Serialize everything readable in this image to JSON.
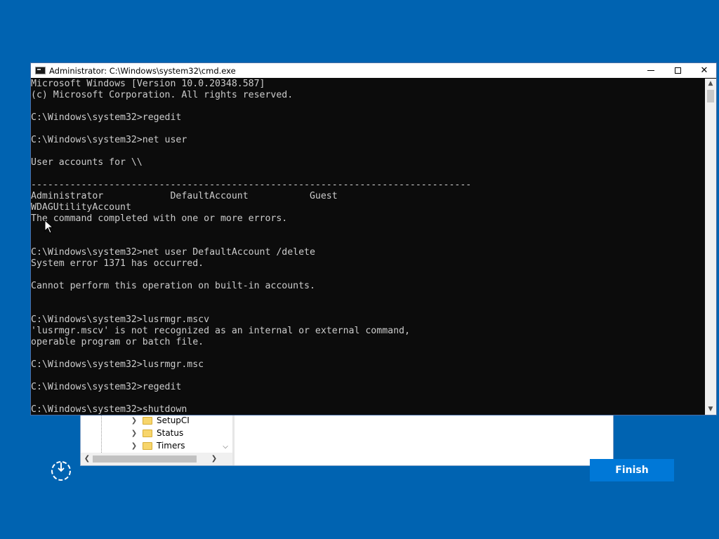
{
  "cmd": {
    "title": "Administrator: C:\\Windows\\system32\\cmd.exe",
    "lines": [
      "Microsoft Windows [Version 10.0.20348.587]",
      "(c) Microsoft Corporation. All rights reserved.",
      "",
      "C:\\Windows\\system32>regedit",
      "",
      "C:\\Windows\\system32>net user",
      "",
      "User accounts for \\\\",
      "",
      "-------------------------------------------------------------------------------",
      "Administrator            DefaultAccount           Guest",
      "WDAGUtilityAccount",
      "The command completed with one or more errors.",
      "",
      "",
      "C:\\Windows\\system32>net user DefaultAccount /delete",
      "System error 1371 has occurred.",
      "",
      "Cannot perform this operation on built-in accounts.",
      "",
      "",
      "C:\\Windows\\system32>lusrmgr.mscv",
      "'lusrmgr.mscv' is not recognized as an internal or external command,",
      "operable program or batch file.",
      "",
      "C:\\Windows\\system32>lusrmgr.msc",
      "",
      "C:\\Windows\\system32>regedit",
      "",
      "C:\\Windows\\system32>shutdown"
    ]
  },
  "regedit": {
    "tree_items": [
      "SetupCI",
      "Status",
      "Timers"
    ]
  },
  "setup": {
    "finish_label": "Finish"
  },
  "colors": {
    "desktop": "#0063b1",
    "console_bg": "#0c0c0c",
    "console_text": "#cccccc",
    "finish_button": "#0078d7"
  },
  "icons": [
    "cmd-icon",
    "minimize-icon",
    "maximize-icon",
    "close-icon",
    "chevron-right-icon",
    "folder-icon",
    "chevron-down-icon",
    "chevron-left-icon",
    "restore-icon",
    "mouse-cursor-icon",
    "chevron-up-icon"
  ]
}
